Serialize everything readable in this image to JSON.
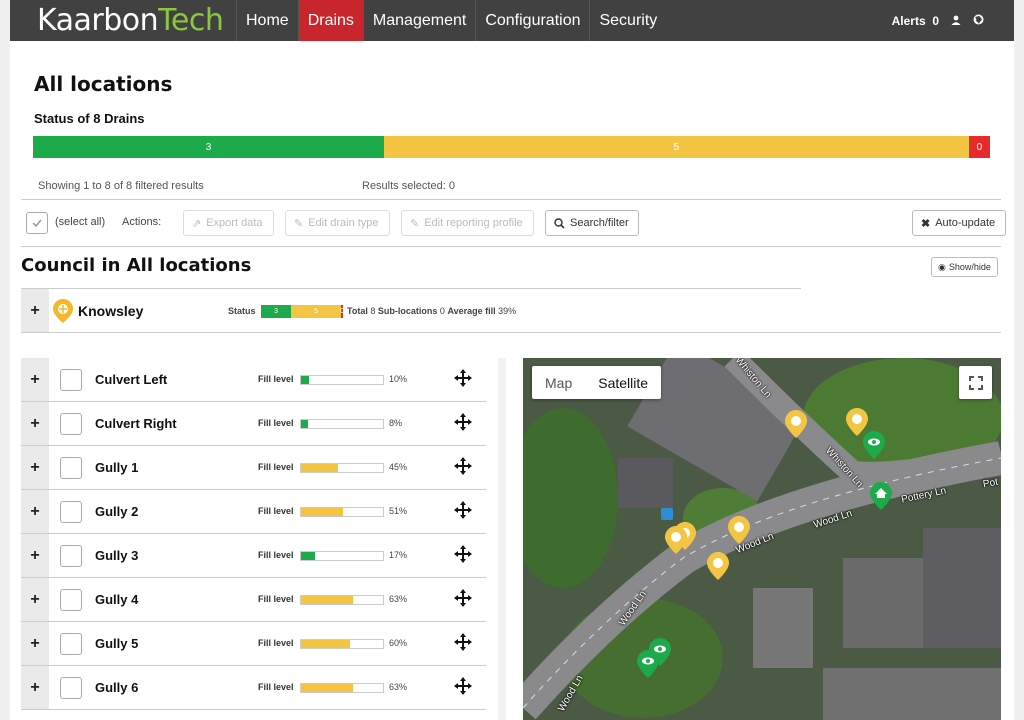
{
  "nav": {
    "brand_a": "Kaarbon",
    "brand_b": "Tech",
    "items": [
      {
        "label": "Home"
      },
      {
        "label": "Drains"
      },
      {
        "label": "Management"
      },
      {
        "label": "Configuration"
      },
      {
        "label": "Security"
      }
    ],
    "active": "Drains",
    "alerts_label": "Alerts",
    "alerts_count": "0"
  },
  "page": {
    "title": "All locations",
    "status_title": "Status of 8 Drains",
    "status": {
      "green": 3,
      "yellow": 5,
      "red": 0
    },
    "showing": "Showing 1 to 8 of 8 filtered results",
    "selected": "Results selected: 0"
  },
  "colors": {
    "green": "#1daa4a",
    "yellow": "#f4c542",
    "red": "#e52b2b",
    "nav_bg": "#414141",
    "nav_active": "#c8262c"
  },
  "toolbar": {
    "select_all": "(select all)",
    "actions_label": "Actions:",
    "export": "Export data",
    "edit_type": "Edit drain type",
    "edit_profile": "Edit reporting profile",
    "search": "Search/filter",
    "auto_update": "Auto-update"
  },
  "council": {
    "title": "Council in All locations",
    "showhide": "Show/hide"
  },
  "location": {
    "name": "Knowsley",
    "status_label": "Status",
    "status": {
      "green": 3,
      "yellow": 5,
      "red": 0
    },
    "total_label": "Total",
    "total": "8",
    "sub_label": "Sub-locations",
    "sub": "0",
    "avg_label": "Average fill",
    "avg": "39%"
  },
  "drains": [
    {
      "name": "Culvert Left",
      "fill_label": "Fill level",
      "fill": 10,
      "fill_text": "10%",
      "color": "#1daa4a"
    },
    {
      "name": "Culvert Right",
      "fill_label": "Fill level",
      "fill": 8,
      "fill_text": "8%",
      "color": "#1daa4a"
    },
    {
      "name": "Gully 1",
      "fill_label": "Fill level",
      "fill": 45,
      "fill_text": "45%",
      "color": "#f4c542"
    },
    {
      "name": "Gully 2",
      "fill_label": "Fill level",
      "fill": 51,
      "fill_text": "51%",
      "color": "#f4c542"
    },
    {
      "name": "Gully 3",
      "fill_label": "Fill level",
      "fill": 17,
      "fill_text": "17%",
      "color": "#1daa4a"
    },
    {
      "name": "Gully 4",
      "fill_label": "Fill level",
      "fill": 63,
      "fill_text": "63%",
      "color": "#f4c542"
    },
    {
      "name": "Gully 5",
      "fill_label": "Fill level",
      "fill": 60,
      "fill_text": "60%",
      "color": "#f4c542"
    },
    {
      "name": "Gully 6",
      "fill_label": "Fill level",
      "fill": 63,
      "fill_text": "63%",
      "color": "#f4c542"
    }
  ],
  "map": {
    "type_map": "Map",
    "type_satellite": "Satellite",
    "selected_type": "Satellite",
    "roads": [
      "Whiston Ln",
      "Whiston Ln",
      "Pottery Ln",
      "Pot",
      "Wood Ln",
      "Wood Ln",
      "Wood Ln",
      "Wood Ln"
    ]
  }
}
